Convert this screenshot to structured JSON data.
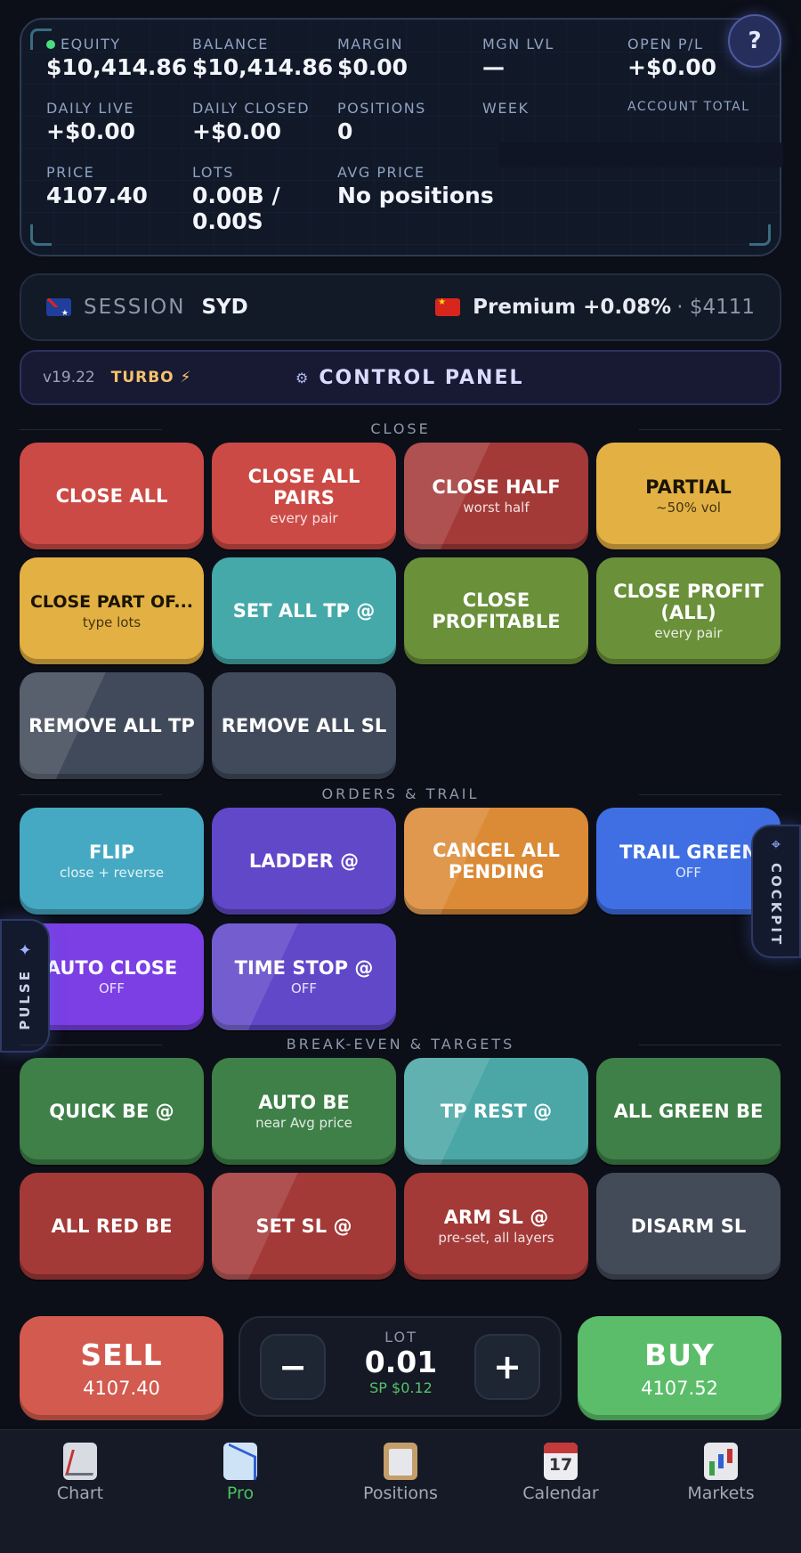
{
  "stats": {
    "row1": [
      {
        "label": "EQUITY",
        "value": "$10,414.86"
      },
      {
        "label": "BALANCE",
        "value": "$10,414.86"
      },
      {
        "label": "MARGIN",
        "value": "$0.00"
      },
      {
        "label": "MGN LVL",
        "value": "—"
      },
      {
        "label": "OPEN P/L",
        "value": "+$0.00"
      }
    ],
    "row2": [
      {
        "label": "DAILY LIVE",
        "value": "+$0.00"
      },
      {
        "label": "DAILY CLOSED",
        "value": "+$0.00"
      },
      {
        "label": "POSITIONS",
        "value": "0"
      },
      {
        "label": "WEEK",
        "value": ""
      },
      {
        "label": "ACCOUNT TOTAL",
        "value": ""
      }
    ],
    "row3": [
      {
        "label": "PRICE",
        "value": "4107.40"
      },
      {
        "label": "LOTS",
        "value": "0.00B /\n0.00S"
      },
      {
        "label": "AVG PRICE",
        "value": "No positions"
      }
    ],
    "help_label": "?"
  },
  "session": {
    "label": "SESSION",
    "value": "SYD",
    "premium": "Premium +0.08%",
    "premium_price": "· $4111"
  },
  "control": {
    "version": "v19.22",
    "turbo": "TURBO ⚡",
    "gear": "⚙",
    "title": "CONTROL PANEL"
  },
  "sections": {
    "close": "CLOSE",
    "orders": "ORDERS & TRAIL",
    "breakeven": "BREAK-EVEN & TARGETS"
  },
  "close_buttons": [
    {
      "title": "CLOSE ALL",
      "sub": ""
    },
    {
      "title": "CLOSE ALL\nPAIRS",
      "sub": "every pair"
    },
    {
      "title": "CLOSE HALF",
      "sub": "worst half"
    },
    {
      "title": "PARTIAL",
      "sub": "~50% vol"
    },
    {
      "title": "CLOSE PART OF...",
      "sub": "type lots"
    },
    {
      "title": "SET ALL TP @",
      "sub": ""
    },
    {
      "title": "CLOSE\nPROFITABLE",
      "sub": ""
    },
    {
      "title": "CLOSE PROFIT\n(ALL)",
      "sub": "every pair"
    },
    {
      "title": "REMOVE ALL TP",
      "sub": ""
    },
    {
      "title": "REMOVE ALL SL",
      "sub": ""
    }
  ],
  "order_buttons": [
    {
      "title": "FLIP",
      "sub": "close + reverse"
    },
    {
      "title": "LADDER @",
      "sub": ""
    },
    {
      "title": "CANCEL ALL\nPENDING",
      "sub": ""
    },
    {
      "title": "TRAIL GREEN",
      "sub": "OFF"
    },
    {
      "title": "AUTO CLOSE",
      "sub": "OFF"
    },
    {
      "title": "TIME STOP @",
      "sub": "OFF"
    }
  ],
  "be_buttons": [
    {
      "title": "QUICK BE @",
      "sub": ""
    },
    {
      "title": "AUTO BE",
      "sub": "near Avg price"
    },
    {
      "title": "TP REST @",
      "sub": ""
    },
    {
      "title": "ALL GREEN BE",
      "sub": ""
    },
    {
      "title": "ALL RED BE",
      "sub": ""
    },
    {
      "title": "SET SL @",
      "sub": ""
    },
    {
      "title": "ARM SL @",
      "sub": "pre-set, all layers"
    },
    {
      "title": "DISARM SL",
      "sub": ""
    }
  ],
  "side_tabs": {
    "cockpit": "COCKPIT",
    "pulse": "PULSE"
  },
  "trade": {
    "sell_label": "SELL",
    "sell_price": "4107.40",
    "buy_label": "BUY",
    "buy_price": "4107.52",
    "lot_label": "LOT",
    "lot_value": "0.01",
    "spread": "SP $0.12",
    "minus": "−",
    "plus": "+"
  },
  "nav": {
    "items": [
      {
        "label": "Chart"
      },
      {
        "label": "Pro"
      },
      {
        "label": "Positions"
      },
      {
        "label": "Calendar",
        "icon_text": "17"
      },
      {
        "label": "Markets"
      }
    ],
    "active": "Pro"
  },
  "colors": {
    "accent_green": "#49c25e",
    "sell_red": "#d25a4e",
    "buy_green": "#5bbd6a"
  }
}
